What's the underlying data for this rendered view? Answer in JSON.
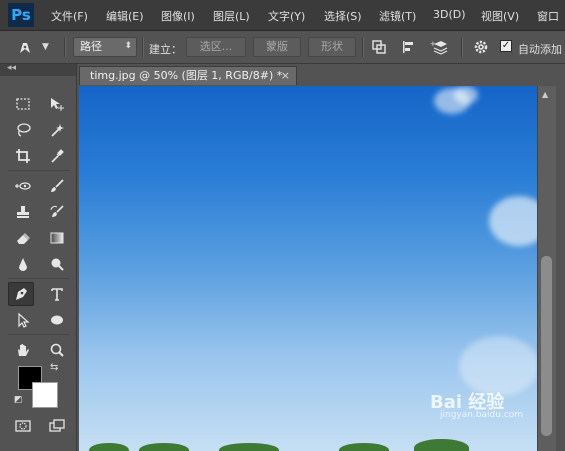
{
  "app": {
    "logo_text": "Ps"
  },
  "menubar": {
    "items": [
      "文件(F)",
      "编辑(E)",
      "图像(I)",
      "图层(L)",
      "文字(Y)",
      "选择(S)",
      "滤镜(T)",
      "3D(D)",
      "视图(V)",
      "窗口"
    ]
  },
  "options": {
    "mode_value": "路径",
    "build_label": "建立：",
    "buttons": [
      "选区...",
      "蒙版",
      "形状"
    ],
    "auto_add_label": "自动添加"
  },
  "document": {
    "tab_title": "timg.jpg @ 50% (图层 1, RGB/8#) *",
    "close_glyph": "×"
  },
  "watermark": {
    "main": "Bai 经验",
    "sub": "jingyan.baidu.com"
  },
  "colors": {
    "foreground": "#000000",
    "background": "#ffffff",
    "menubar_bg": "#3b3b3b",
    "panel_bg": "#535353"
  },
  "icons": [
    "marquee-icon",
    "move-icon",
    "lasso-icon",
    "magic-wand-icon",
    "crop-icon",
    "eyedropper-icon",
    "spot-healing-icon",
    "brush-icon",
    "clone-stamp-icon",
    "history-brush-icon",
    "eraser-icon",
    "gradient-icon",
    "blur-icon",
    "dodge-icon",
    "pen-icon",
    "type-icon",
    "path-selection-icon",
    "ellipse-icon",
    "hand-icon",
    "zoom-icon"
  ]
}
